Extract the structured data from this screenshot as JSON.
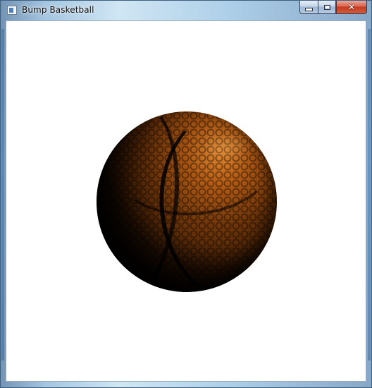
{
  "window": {
    "title": "Bump Basketball",
    "icons": {
      "app": "app-window-icon",
      "minimize": "minimize-icon",
      "maximize": "maximize-icon",
      "close": "close-icon"
    },
    "caption": {
      "minimize": "",
      "maximize": "",
      "close": "✕"
    }
  },
  "canvas": {
    "background": "#ffffff",
    "object": "bump-mapped basketball",
    "ball_color": "#b3631b"
  }
}
